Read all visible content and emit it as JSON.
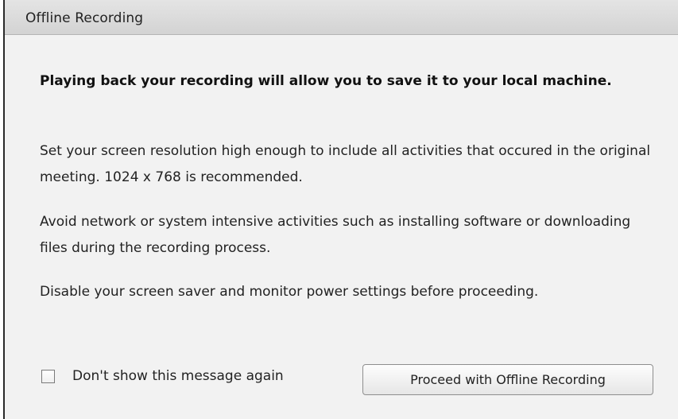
{
  "dialog": {
    "title": "Offline Recording",
    "paragraphs": [
      "Playing back your recording will allow you to save it to your local machine.",
      "Set your screen resolution high enough to include all activities that occured in the original meeting. 1024 x 768 is recommended.",
      "Avoid network or system intensive activities such as installing software or downloading files during the recording process.",
      "Disable your screen saver and monitor power settings before proceeding."
    ],
    "checkbox": {
      "label": "Don't show this message again",
      "checked": false
    },
    "proceed_button_label": "Proceed with Offline Recording"
  },
  "colors": {
    "titlebar": "#d9d9d9",
    "background": "#f2f2f2",
    "text": "#222222"
  }
}
